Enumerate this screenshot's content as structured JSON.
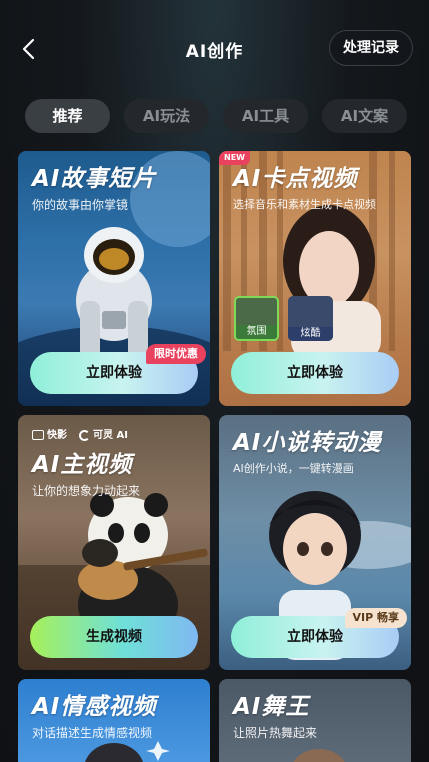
{
  "header": {
    "title": "AI创作",
    "records_label": "处理记录"
  },
  "tabs": [
    {
      "label": "推荐",
      "active": true
    },
    {
      "label": "AI玩法",
      "active": false
    },
    {
      "label": "AI工具",
      "active": false
    },
    {
      "label": "AI文案",
      "active": false
    }
  ],
  "cards": [
    {
      "title": "AI故事短片",
      "subtitle": "你的故事由你掌镜",
      "cta": "立即体验",
      "badge": "限时优惠"
    },
    {
      "title": "AI卡点视频",
      "subtitle": "选择音乐和素材生成卡点视频",
      "cta": "立即体验",
      "badge": "NEW",
      "templates": [
        "氛围",
        "炫酷"
      ]
    },
    {
      "title": "AI主视频",
      "subtitle": "让你的想象力动起来",
      "cta": "生成视频",
      "brands": [
        "快影",
        "可灵 AI"
      ]
    },
    {
      "title": "AI小说转动漫",
      "subtitle": "AI创作小说，一键转漫画",
      "cta": "立即体验",
      "badge": "VIP 畅享"
    },
    {
      "title": "AI情感视频",
      "subtitle": "对话描述生成情感视频"
    },
    {
      "title": "AI舞王",
      "subtitle": "让照片热舞起来"
    }
  ],
  "colors": {
    "cta_gradient_start": "#8ff0d8",
    "cta_gradient_end": "#a9ccf5",
    "badge_red": "#e8425e",
    "badge_vip": "#f6e3cf"
  }
}
